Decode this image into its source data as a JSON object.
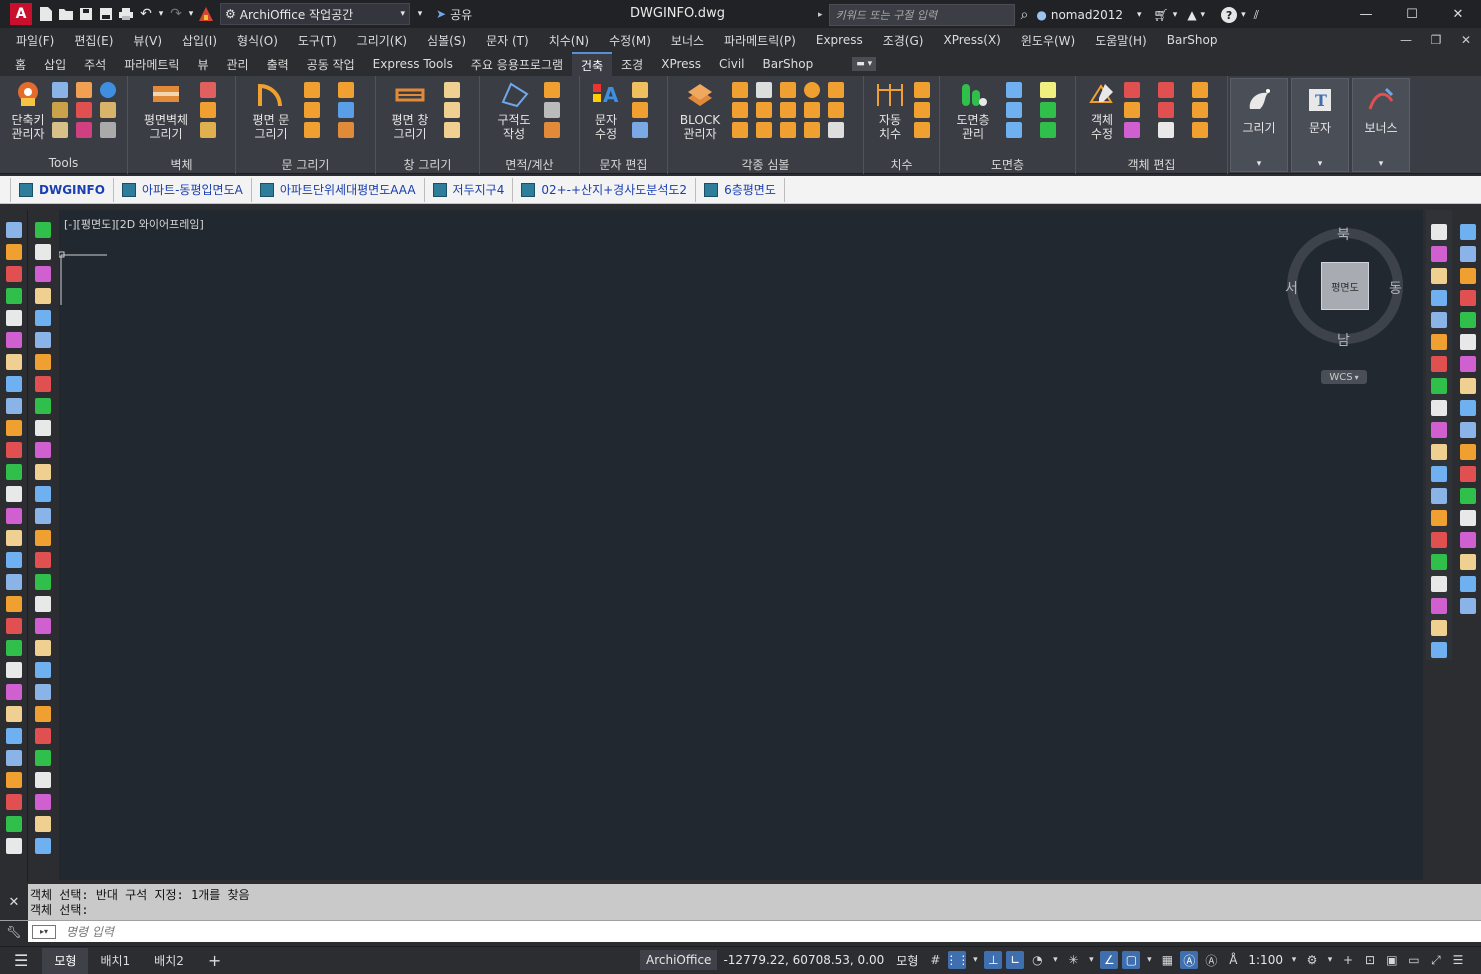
{
  "titlebar": {
    "logo": "A",
    "workspace": "ArchiOffice 작업공간",
    "share": "공유",
    "filename": "DWGINFO.dwg",
    "search_placeholder": "키워드 또는 구절 입력",
    "user": "nomad2012"
  },
  "menubar": {
    "items": [
      "파일(F)",
      "편집(E)",
      "뷰(V)",
      "삽입(I)",
      "형식(O)",
      "도구(T)",
      "그리기(K)",
      "심볼(S)",
      "문자 (T)",
      "치수(N)",
      "수정(M)",
      "보너스",
      "파라메트릭(P)",
      "Express",
      "조경(G)",
      "XPress(X)",
      "윈도우(W)",
      "도움말(H)",
      "BarShop"
    ]
  },
  "ribbon_tabs": {
    "items": [
      "홈",
      "삽입",
      "주석",
      "파라메트릭",
      "뷰",
      "관리",
      "출력",
      "공동 작업",
      "Express Tools",
      "주요 응용프로그램",
      "건축",
      "조경",
      "XPress",
      "Civil",
      "BarShop"
    ],
    "active_index": 10
  },
  "ribbon": {
    "tools_title": "Tools",
    "tools_btn": [
      "단축키",
      "관리자"
    ],
    "wall_title": "벽체",
    "wall_btn": [
      "평면벽체",
      "그리기"
    ],
    "door_title": "문 그리기",
    "door_btn": [
      "평면 문",
      "그리기"
    ],
    "window_title": "창 그리기",
    "window_btn": [
      "평면 창",
      "그리기"
    ],
    "area_title": "면적/계산",
    "area_btn": [
      "구적도",
      "작성"
    ],
    "text_title": "문자 편집",
    "text_btn": [
      "문자",
      "수정"
    ],
    "symbol_title": "각종 심볼",
    "symbol_btn": [
      "BLOCK",
      "관리자"
    ],
    "dim_title": "치수",
    "dim_btn": [
      "자동",
      "치수"
    ],
    "layer_title": "도면층",
    "layer_btn": [
      "도면층",
      "관리"
    ],
    "obj_title": "객체 편집",
    "obj_btn": [
      "객체",
      "수정"
    ],
    "draw_btn": "그리기",
    "moji_btn": "문자",
    "bonus_btn": "보너스"
  },
  "filetabs": {
    "items": [
      "DWGINFO",
      "아파트-동평입면도A",
      "아파트단위세대평면도AAA",
      "저두지구4",
      "02+-+산지+경사도분석도2",
      "6층평면도"
    ],
    "active_index": 0
  },
  "viewport": {
    "label": "[-][평면도][2D 와이어프레임]",
    "compass": {
      "north": "북",
      "south": "남",
      "east": "동",
      "west": "서",
      "center": "평면도"
    },
    "wcs": "WCS"
  },
  "command": {
    "history": [
      "객체 선택: 반대 구석 지정: 1개를 찾음",
      "객체 선택:"
    ],
    "placeholder": "명령 입력"
  },
  "statusbar": {
    "tabs": [
      "모형",
      "배치1",
      "배치2"
    ],
    "active_index": 0,
    "app": "ArchiOffice",
    "coords": "-12779.22, 60708.53, 0.00",
    "space": "모형",
    "scale": "1:100"
  },
  "colors": {
    "canvas": "#212830",
    "chrome": "#2b2d31",
    "ribbon": "#3a3d43",
    "accent": "#3f6fae"
  }
}
